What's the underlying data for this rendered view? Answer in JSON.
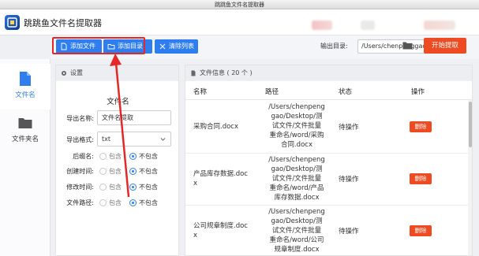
{
  "window": {
    "title": "跳跳鱼文件名提取器"
  },
  "app": {
    "title": "跳跳鱼文件名提取器"
  },
  "toolbar": {
    "add_file": "添加文件",
    "add_dir": "添加目录",
    "clear_list": "清除列表",
    "output_label": "输出目录:",
    "output_path": "/Users/chenpenggao/D",
    "start": "开始提取"
  },
  "nav": {
    "items": [
      {
        "label": "文件名",
        "icon": "file-icon",
        "active": true
      },
      {
        "label": "文件夹名",
        "icon": "folder-icon",
        "active": false
      }
    ]
  },
  "settings": {
    "header": "设置",
    "title": "文件名",
    "export_name_label": "导出名称:",
    "export_name_value": "文件名提取",
    "export_format_label": "导出格式:",
    "export_format_value": "txt",
    "options": [
      {
        "label": "后缀名:",
        "include": "包含",
        "exclude": "不包含",
        "selected": "exclude"
      },
      {
        "label": "创建时间:",
        "include": "包含",
        "exclude": "不包含",
        "selected": "exclude"
      },
      {
        "label": "修改时间:",
        "include": "包含",
        "exclude": "不包含",
        "selected": "exclude"
      },
      {
        "label": "文件路径:",
        "include": "包含",
        "exclude": "不包含",
        "selected": "exclude"
      }
    ]
  },
  "files": {
    "header": "文件信息 ( 20 个 )",
    "columns": {
      "name": "名称",
      "path": "路径",
      "status": "状态",
      "action": "操作"
    },
    "rows": [
      {
        "name": [
          "采购合同.docx"
        ],
        "path": [
          "/Users/chenpeng",
          "gao/Desktop/测",
          "试文件/文件批量",
          "重命名/word/采购",
          "合同.docx"
        ],
        "status": "待操作",
        "action": "删除"
      },
      {
        "name": [
          "产品库存数据.doc",
          "x"
        ],
        "path": [
          "/Users/chenpeng",
          "gao/Desktop/测",
          "试文件/文件批量",
          "重命名/word/产品",
          "库存数据.docx"
        ],
        "status": "待操作",
        "action": "删除"
      },
      {
        "name": [
          "公司规章制度.doc",
          "x"
        ],
        "path": [
          "/Users/chenpeng",
          "gao/Desktop/测",
          "试文件/文件批量",
          "重命名/word/公司",
          "规章制度.docx"
        ],
        "status": "待操作",
        "action": "删除"
      }
    ]
  },
  "colors": {
    "primary": "#2f7ef0",
    "accent": "#ee4b22",
    "annotation": "#e62727"
  }
}
